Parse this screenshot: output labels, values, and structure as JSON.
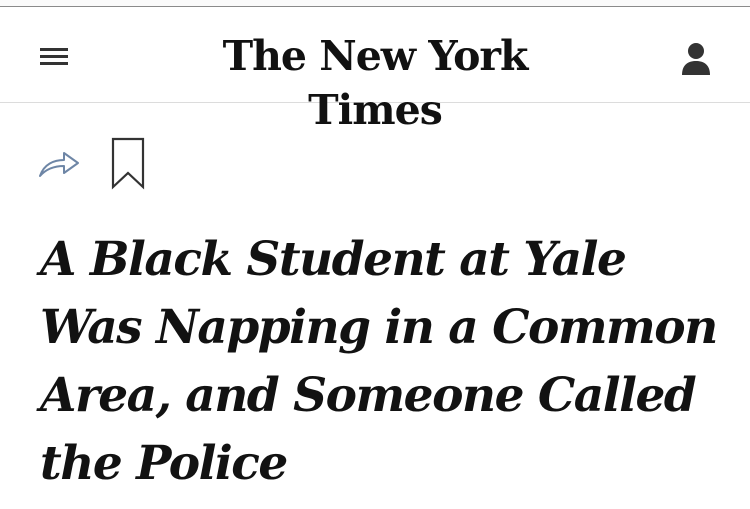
{
  "masthead": {
    "logo_text": "The New York Times",
    "menu_icon": "hamburger-menu-icon",
    "account_icon": "user-account-icon"
  },
  "article_tools": {
    "share_icon": "share-arrow-icon",
    "bookmark_icon": "bookmark-icon"
  },
  "article": {
    "headline": "A Black Student at Yale Was Napping in a Common Area, and Someone Called the Police"
  },
  "colors": {
    "icon_dark": "#333333",
    "share_icon_blue": "#6e86a6",
    "text": "#121212",
    "divider": "#dcdcdc"
  }
}
